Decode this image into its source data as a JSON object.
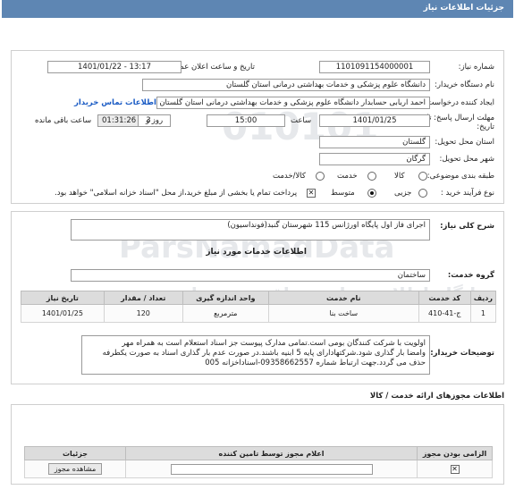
{
  "header": {
    "title": "جزئیات اطلاعات نیاز"
  },
  "info": {
    "need_number_label": "شماره نیاز:",
    "need_number": "1101091154000001",
    "announce_label": "تاریخ و ساعت اعلان عمومی:",
    "announce_value": "1401/01/22 - 13:17",
    "buyer_label": "نام دستگاه خریدار:",
    "buyer_value": "دانشگاه علوم پزشکی و خدمات بهداشتی درمانی استان گلستان",
    "creator_label": "ایجاد کننده درخواست:",
    "creator_value": "احمد اربابی حسابدار دانشگاه علوم پزشکی و خدمات بهداشتی درمانی استان گلستان",
    "contact_link": "اطلاعات تماس خریدار",
    "deadline_label": "مهلت ارسال پاسخ: تا",
    "deadline_label2": "تاریخ:",
    "deadline_date": "1401/01/25",
    "time_label": "ساعت",
    "deadline_time": "15:00",
    "days_value": "3",
    "days_label": "روز و",
    "remaining_time": "01:31:26",
    "remaining_label": "ساعت باقی مانده",
    "province_label": "استان محل تحویل:",
    "province_value": "گلستان",
    "city_label": "شهر محل تحویل:",
    "city_value": "گرگان",
    "category_label": "طبقه بندی موضوعی:",
    "category_options": [
      "کالا",
      "خدمت",
      "کالا/خدمت"
    ],
    "process_label": "نوع فرآیند خرید :",
    "process_options": [
      "جزیی",
      "متوسط"
    ],
    "payment_note": "پرداخت تمام یا بخشی از مبلغ خرید،از محل \"اسناد خزانه اسلامی\" خواهد بود."
  },
  "need": {
    "summary_label": "شرح کلی نیاز:",
    "summary_value": "اجرای فاز اول پایگاه اورژانس 115 شهرستان گنبد(فونداسیون)",
    "services_title": "اطلاعات خدمات مورد نیاز",
    "group_label": "گروه خدمت:",
    "group_value": "ساختمان",
    "table_headers": [
      "ردیف",
      "کد خدمت",
      "نام خدمت",
      "واحد اندازه گیری",
      "تعداد / مقدار",
      "تاریخ نیاز"
    ],
    "rows": [
      {
        "idx": "1",
        "code": "ج-41-410",
        "name": "ساخت بنا",
        "unit": "مترمربع",
        "qty": "120",
        "date": "1401/01/25"
      }
    ],
    "desc_label": "توضیحات خریدار:",
    "desc_lines": [
      "اولویت با شرکت کنندگان بومی است.تمامی مدارک پیوست جز اسناد استعلام است  به همراه مهر",
      "وامضا بار گذاری شود.شرکتهادارای پایه 5 ابنیه  باشند.در صورت عدم بار گذاری اسناد به صورت یکطرفه",
      "حذف می گردد.جهت ارتباط شماره  09358662557-اسناداخزانه 005"
    ]
  },
  "permits": {
    "title": "اطلاعات مجوزهای ارائه خدمت / کالا",
    "headers": [
      "الزامی بودن مجوز",
      "اعلام مجوز توسط تامین کننده",
      "جزئیات"
    ],
    "view_button": "مشاهده مجوز"
  },
  "watermark": {
    "line1": "ParsNamadData",
    "line2": "پایگاه اطلاع رسانی مناقصه و مزایده",
    "digits": "010101"
  }
}
